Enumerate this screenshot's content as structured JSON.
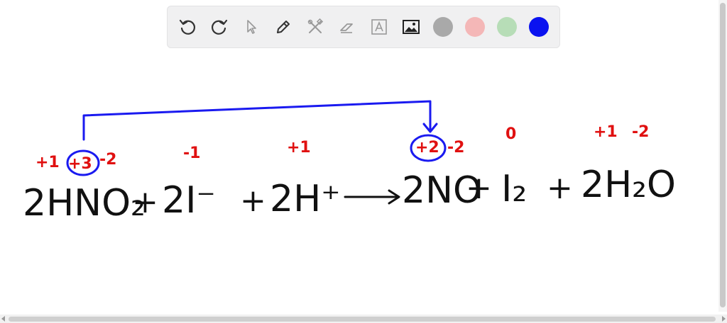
{
  "toolbar": {
    "tools": [
      {
        "name": "undo-icon",
        "label": "Undo"
      },
      {
        "name": "redo-icon",
        "label": "Redo"
      },
      {
        "name": "select-arrow-icon",
        "label": "Select"
      },
      {
        "name": "pen-icon",
        "label": "Pen"
      },
      {
        "name": "tools-icon",
        "label": "Tools"
      },
      {
        "name": "eraser-icon",
        "label": "Eraser"
      },
      {
        "name": "text-icon",
        "label": "Text"
      },
      {
        "name": "image-icon",
        "label": "Image"
      }
    ],
    "colors": [
      "#a9a9a9",
      "#f4b7b7",
      "#b7ddb7",
      "#0a12f0"
    ]
  },
  "equation": {
    "reactants": [
      "2HNO₂",
      "2I⁻",
      "2H⁺"
    ],
    "products": [
      "2NO",
      "I₂",
      "2H₂O"
    ],
    "oxidation_numbers": {
      "HNO2": [
        "+1",
        "+3",
        "-2"
      ],
      "I": "-1",
      "H": "+1",
      "NO": [
        "+2",
        "-2"
      ],
      "I2": "0",
      "H2O": [
        "+1",
        "-2"
      ]
    }
  },
  "colors": {
    "ink": "#111111",
    "red": "#e01010",
    "blue": "#1a1af0"
  }
}
